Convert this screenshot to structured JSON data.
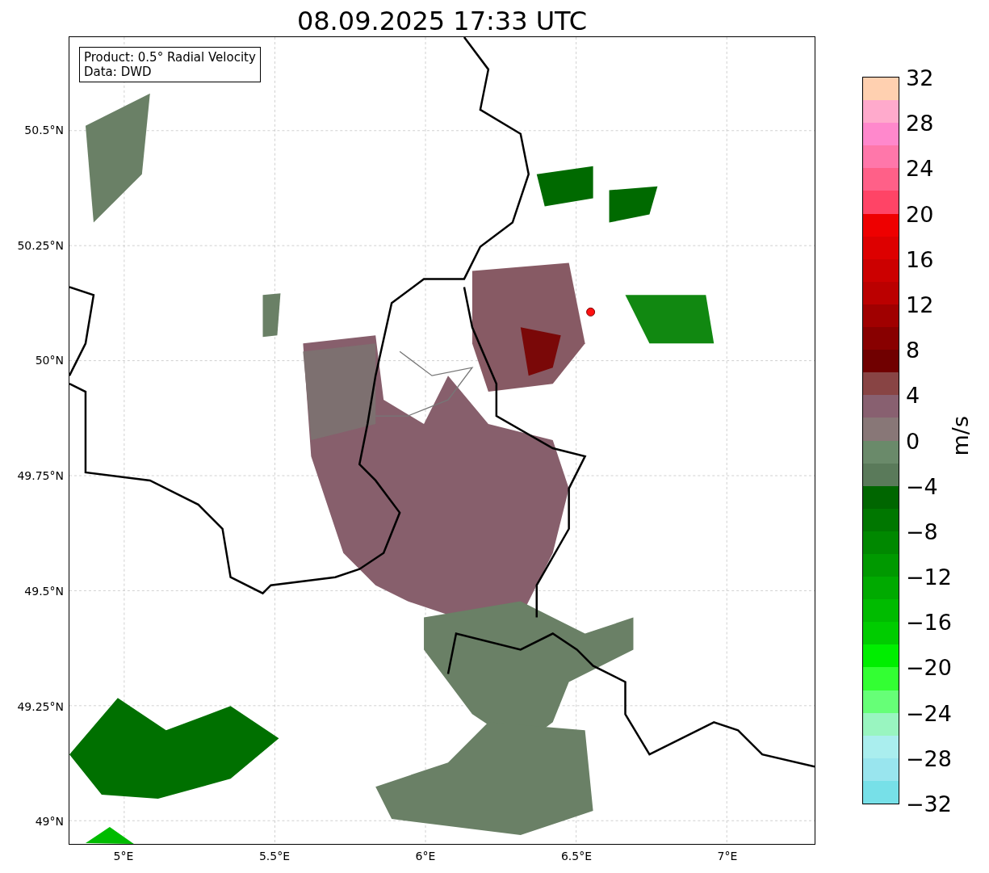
{
  "title": "08.09.2025 17:33 UTC",
  "info_box": {
    "lines": [
      "Product: 0.5° Radial Velocity",
      "Data: DWD"
    ]
  },
  "map": {
    "y_ticks": [
      "50.5°N",
      "50.25°N",
      "50°N",
      "49.75°N",
      "49.5°N",
      "49.25°N",
      "49°N"
    ],
    "x_ticks": [
      "5°E",
      "5.5°E",
      "6°E",
      "6.5°E",
      "7°E"
    ]
  },
  "colorbar": {
    "label": "m/s",
    "ticks": [
      "32",
      "28",
      "24",
      "20",
      "16",
      "12",
      "8",
      "4",
      "0",
      "−4",
      "−8",
      "−12",
      "−16",
      "−20",
      "−24",
      "−28",
      "−32"
    ],
    "segments": [
      {
        "color": "#ffd0b0"
      },
      {
        "color": "#ffaacc"
      },
      {
        "color": "#ff88cc"
      },
      {
        "color": "#ff77aa"
      },
      {
        "color": "#ff6088"
      },
      {
        "color": "#ff4466"
      },
      {
        "color": "#ee0000"
      },
      {
        "color": "#dd0000"
      },
      {
        "color": "#cc0000"
      },
      {
        "color": "#bb0000"
      },
      {
        "color": "#a00000"
      },
      {
        "color": "#880000"
      },
      {
        "color": "#700000"
      },
      {
        "color": "#884444"
      },
      {
        "color": "#886070"
      },
      {
        "color": "#887777"
      },
      {
        "color": "#6a8a6a"
      },
      {
        "color": "#5a7a5a"
      },
      {
        "color": "#006600"
      },
      {
        "color": "#007700"
      },
      {
        "color": "#008800"
      },
      {
        "color": "#009900"
      },
      {
        "color": "#00aa00"
      },
      {
        "color": "#00bb00"
      },
      {
        "color": "#00cc00"
      },
      {
        "color": "#00ee00"
      },
      {
        "color": "#33ff33"
      },
      {
        "color": "#66ff77"
      },
      {
        "color": "#99f5c0"
      },
      {
        "color": "#aaeeee"
      },
      {
        "color": "#99e5ee"
      },
      {
        "color": "#77e0e8"
      }
    ]
  }
}
